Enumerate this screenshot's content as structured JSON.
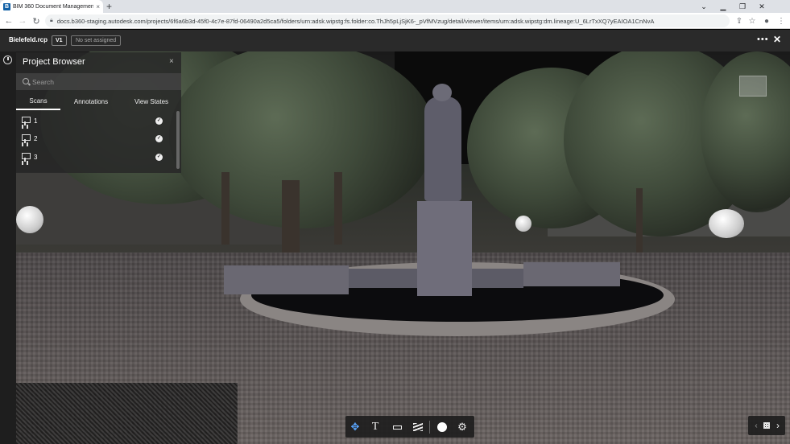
{
  "browser": {
    "tab_title": "BIM 360 Document Management",
    "favicon_letter": "B",
    "tab_close": "×",
    "new_tab": "+",
    "url": "docs.b360-staging.autodesk.com/projects/6f6a6b3d-45f0-4c7e-87fd-06490a2d5ca5/folders/urn:adsk.wipstg:fs.folder:co.ThJh5pLjSjK6-_pVfMVzug/detail/viewer/items/urn:adsk.wipstg:dm.lineage:U_6LrTxXQ7yEAIOA1CnNvA"
  },
  "header": {
    "filename": "Bielefeld.rcp",
    "version": "V1",
    "set_badge": "No set assigned",
    "more": "•••",
    "close": "✕"
  },
  "project_browser": {
    "title": "Project Browser",
    "close": "×",
    "search_placeholder": "Search",
    "tabs": [
      {
        "label": "Scans"
      },
      {
        "label": "Annotations"
      },
      {
        "label": "View States"
      }
    ],
    "scans": [
      {
        "label": "1",
        "visible": true
      },
      {
        "label": "2",
        "visible": true
      },
      {
        "label": "3",
        "visible": true
      }
    ]
  },
  "toolbar": {
    "tools": [
      "orbit-icon",
      "text-icon",
      "measure-icon",
      "layers-icon",
      "circle-icon",
      "gear-icon"
    ],
    "active": "orbit-icon"
  },
  "nav": {
    "prev": "‹",
    "next": "›"
  },
  "colors": {
    "accent": "#5aa6ff",
    "header_bg": "#2a2a2a"
  }
}
